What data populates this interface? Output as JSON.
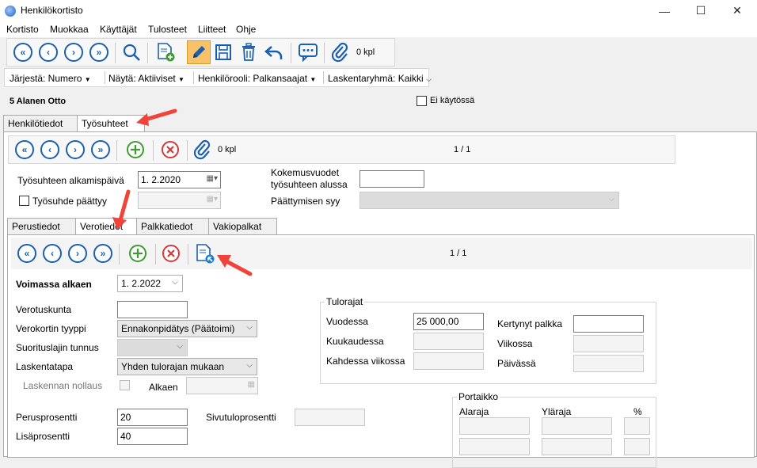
{
  "window": {
    "title": "Henkilökortisto",
    "minimize": "—",
    "maximize": "☐",
    "close": "✕"
  },
  "menu": [
    "Kortisto",
    "Muokkaa",
    "Käyttäjät",
    "Tulosteet",
    "Liitteet",
    "Ohje"
  ],
  "toolbar": {
    "attachment_count": "0 kpl"
  },
  "filters": {
    "sort": "Järjestä: Numero",
    "show": "Näytä: Aktiiviset",
    "role": "Henkilörooli: Palkansaajat",
    "group": "Laskentaryhmä: Kaikki"
  },
  "person": {
    "header": "5  Alanen Otto",
    "inactive_label": "Ei käytössä"
  },
  "main_tabs": [
    "Henkilötiedot",
    "Työsuhteet"
  ],
  "employment": {
    "attachment_count": "0 kpl",
    "pager": "1 / 1",
    "start_label": "Työsuhteen alkamispäivä",
    "start_value": "1.  2.2020",
    "ended_label": "Työsuhde päättyy",
    "experience_label_1": "Kokemusvuodet",
    "experience_label_2": "työsuhteen alussa",
    "end_reason_label": "Päättymisen syy"
  },
  "sub_tabs": [
    "Perustiedot",
    "Verotiedot",
    "Palkkatiedot",
    "Vakiopalkat"
  ],
  "tax": {
    "pager": "1 / 1",
    "valid_from_label": "Voimassa alkaen",
    "valid_from_value": "1.  2.2022",
    "municipality_label": "Verotuskunta",
    "card_type_label": "Verokortin tyyppi",
    "card_type_value": "Ennakonpidätys (Päätoimi)",
    "payment_type_label": "Suorituslajin tunnus",
    "calc_method_label": "Laskentatapa",
    "calc_method_value": "Yhden tulorajan mukaan",
    "reset_label": "Laskennan nollaus",
    "from_label": "Alkaen",
    "base_pct_label": "Perusprosentti",
    "base_pct_value": "20",
    "extra_pct_label": "Lisäprosentti",
    "extra_pct_value": "40",
    "side_pct_label": "Sivutuloprosentti"
  },
  "income_limits": {
    "title": "Tulorajat",
    "yearly_label": "Vuodessa",
    "yearly_value": "25 000,00",
    "monthly_label": "Kuukaudessa",
    "biweekly_label": "Kahdessa viikossa",
    "accrued_label": "Kertynyt palkka",
    "weekly_label": "Viikossa",
    "daily_label": "Päivässä"
  },
  "scale": {
    "title": "Portaikko",
    "lower": "Alaraja",
    "upper": "Yläraja",
    "pct": "%"
  },
  "colors": {
    "nav_blue": "#1a5fb0",
    "add_green": "#3d9b2f",
    "delete_red": "#d13a3a",
    "arrow_red": "#f0443a"
  }
}
